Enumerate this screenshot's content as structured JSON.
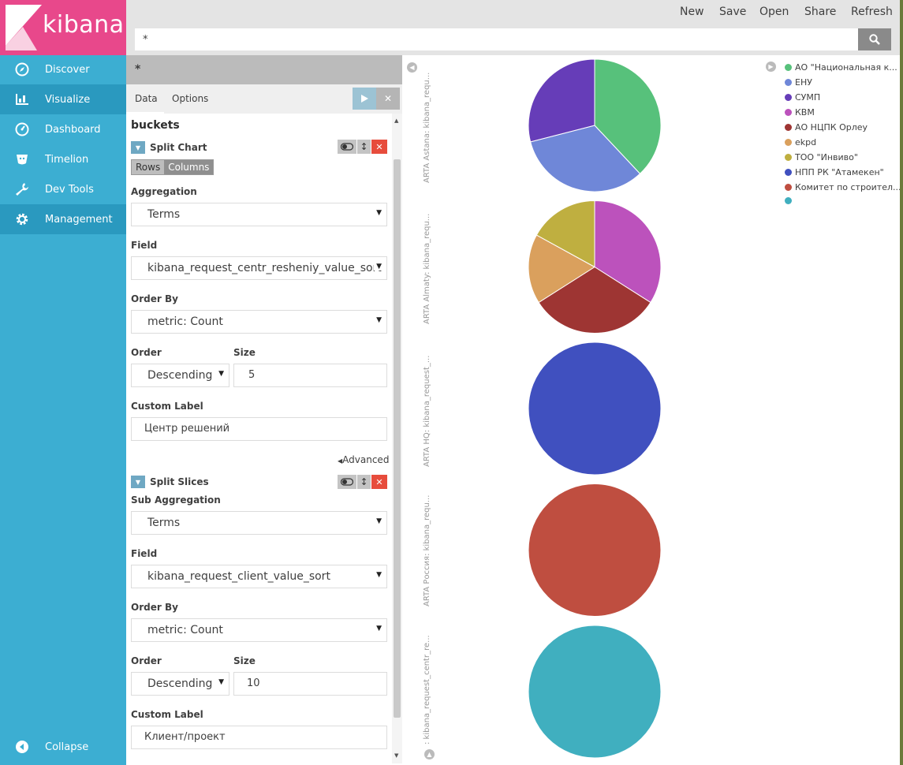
{
  "brand": {
    "logo_text": "kibana",
    "logo_color": "#e8488b"
  },
  "nav": {
    "items": [
      {
        "label": "Discover",
        "icon": "compass-icon"
      },
      {
        "label": "Visualize",
        "icon": "bar-chart-icon",
        "active": true
      },
      {
        "label": "Dashboard",
        "icon": "dashboard-icon"
      },
      {
        "label": "Timelion",
        "icon": "timelion-icon"
      },
      {
        "label": "Dev Tools",
        "icon": "wrench-icon"
      },
      {
        "label": "Management",
        "icon": "gear-icon"
      }
    ],
    "collapse_label": "Collapse"
  },
  "topbar": {
    "links": [
      "New",
      "Save",
      "Open",
      "Share",
      "Refresh"
    ],
    "search_value": "*"
  },
  "editor": {
    "title": "*",
    "tabs": [
      "Data",
      "Options"
    ],
    "section_title": "buckets",
    "split_chart": {
      "title": "Split Chart",
      "rows_label": "Rows",
      "columns_label": "Columns",
      "aggregation_label": "Aggregation",
      "aggregation_value": "Terms",
      "field_label": "Field",
      "field_value": "kibana_request_centr_resheniy_value_sort",
      "order_by_label": "Order By",
      "order_by_value": "metric: Count",
      "order_label": "Order",
      "order_value": "Descending",
      "size_label": "Size",
      "size_value": "5",
      "custom_label_label": "Custom Label",
      "custom_label_value": "Центр решений",
      "advanced_label": "Advanced"
    },
    "split_slices": {
      "title": "Split Slices",
      "aggregation_label": "Sub Aggregation",
      "aggregation_value": "Terms",
      "field_label": "Field",
      "field_value": "kibana_request_client_value_sort",
      "order_by_label": "Order By",
      "order_by_value": "metric: Count",
      "order_label": "Order",
      "order_value": "Descending",
      "size_label": "Size",
      "size_value": "10",
      "custom_label_label": "Custom Label",
      "custom_label_value": "Клиент/проект"
    }
  },
  "chart_data": {
    "type": "pie",
    "row_labels": [
      "ARTA Astana: kibana_requ...",
      "ARTA Almaty: kibana_requ...",
      "ARTA HQ: kibana_request_...",
      "ARTA Россия: kibana_requ...",
      ": kibana_request_centr_re..."
    ],
    "legend": [
      {
        "name": "АО \"Национальная к...",
        "color": "#57c17b"
      },
      {
        "name": "ЕНУ",
        "color": "#6f87d8"
      },
      {
        "name": "СУМП",
        "color": "#663db8"
      },
      {
        "name": "КВМ",
        "color": "#bc52bc"
      },
      {
        "name": "АО НЦПК Орлеу",
        "color": "#9e3533"
      },
      {
        "name": "ekpd",
        "color": "#daa05d"
      },
      {
        "name": "ТОО \"Инвиво\"",
        "color": "#bfaf40"
      },
      {
        "name": "НПП РК \"Атамекен\"",
        "color": "#4050bf"
      },
      {
        "name": "Комитет по строител...",
        "color": "#bf4e40"
      },
      {
        "name": "",
        "color": "#40afbf"
      }
    ],
    "pies": [
      {
        "slices": [
          {
            "legend": 0,
            "value": 38
          },
          {
            "legend": 1,
            "value": 33
          },
          {
            "legend": 2,
            "value": 29
          }
        ]
      },
      {
        "slices": [
          {
            "legend": 3,
            "value": 34
          },
          {
            "legend": 4,
            "value": 32
          },
          {
            "legend": 5,
            "value": 17
          },
          {
            "legend": 6,
            "value": 17
          }
        ]
      },
      {
        "slices": [
          {
            "legend": 7,
            "value": 100
          }
        ]
      },
      {
        "slices": [
          {
            "legend": 8,
            "value": 100
          }
        ]
      },
      {
        "slices": [
          {
            "legend": 9,
            "value": 100
          }
        ]
      }
    ]
  }
}
